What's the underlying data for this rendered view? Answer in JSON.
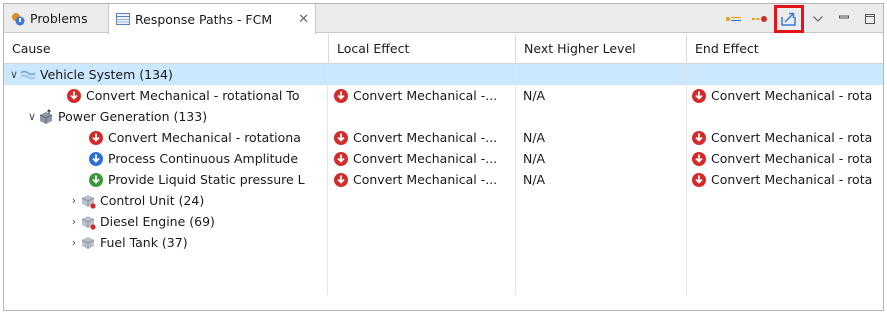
{
  "tabs": {
    "problems_label": "Problems",
    "response_label": "Response Paths - FCM",
    "close_glyph": "✕"
  },
  "columns": [
    "Cause",
    "Local Effect",
    "Next Higher Level",
    "End Effect"
  ],
  "rows": [
    {
      "cause": "Vehicle System (134)",
      "local": "",
      "next": "",
      "end": ""
    },
    {
      "cause": "Convert Mechanical - rotational To",
      "local": "Convert Mechanical -...",
      "next": "N/A",
      "end": "Convert Mechanical - rota"
    },
    {
      "cause": "Power Generation (133)",
      "local": "",
      "next": "",
      "end": ""
    },
    {
      "cause": "Convert Mechanical - rotationa",
      "local": "Convert Mechanical -...",
      "next": "N/A",
      "end": "Convert Mechanical - rota"
    },
    {
      "cause": "Process Continuous Amplitude",
      "local": "Convert Mechanical -...",
      "next": "N/A",
      "end": "Convert Mechanical - rota"
    },
    {
      "cause": "Provide Liquid Static pressure L",
      "local": "Convert Mechanical -...",
      "next": "N/A",
      "end": "Convert Mechanical - rota"
    },
    {
      "cause": "Control Unit (24)",
      "local": "",
      "next": "",
      "end": ""
    },
    {
      "cause": "Diesel Engine (69)",
      "local": "",
      "next": "",
      "end": ""
    },
    {
      "cause": "Fuel Tank (37)",
      "local": "",
      "next": "",
      "end": ""
    }
  ],
  "colors": {
    "selection": "#cce8ff",
    "failure_red": "#d42a2a",
    "failure_blue": "#2f6fd6",
    "failure_green": "#3a9a3a",
    "highlight_box": "#e4141b"
  }
}
